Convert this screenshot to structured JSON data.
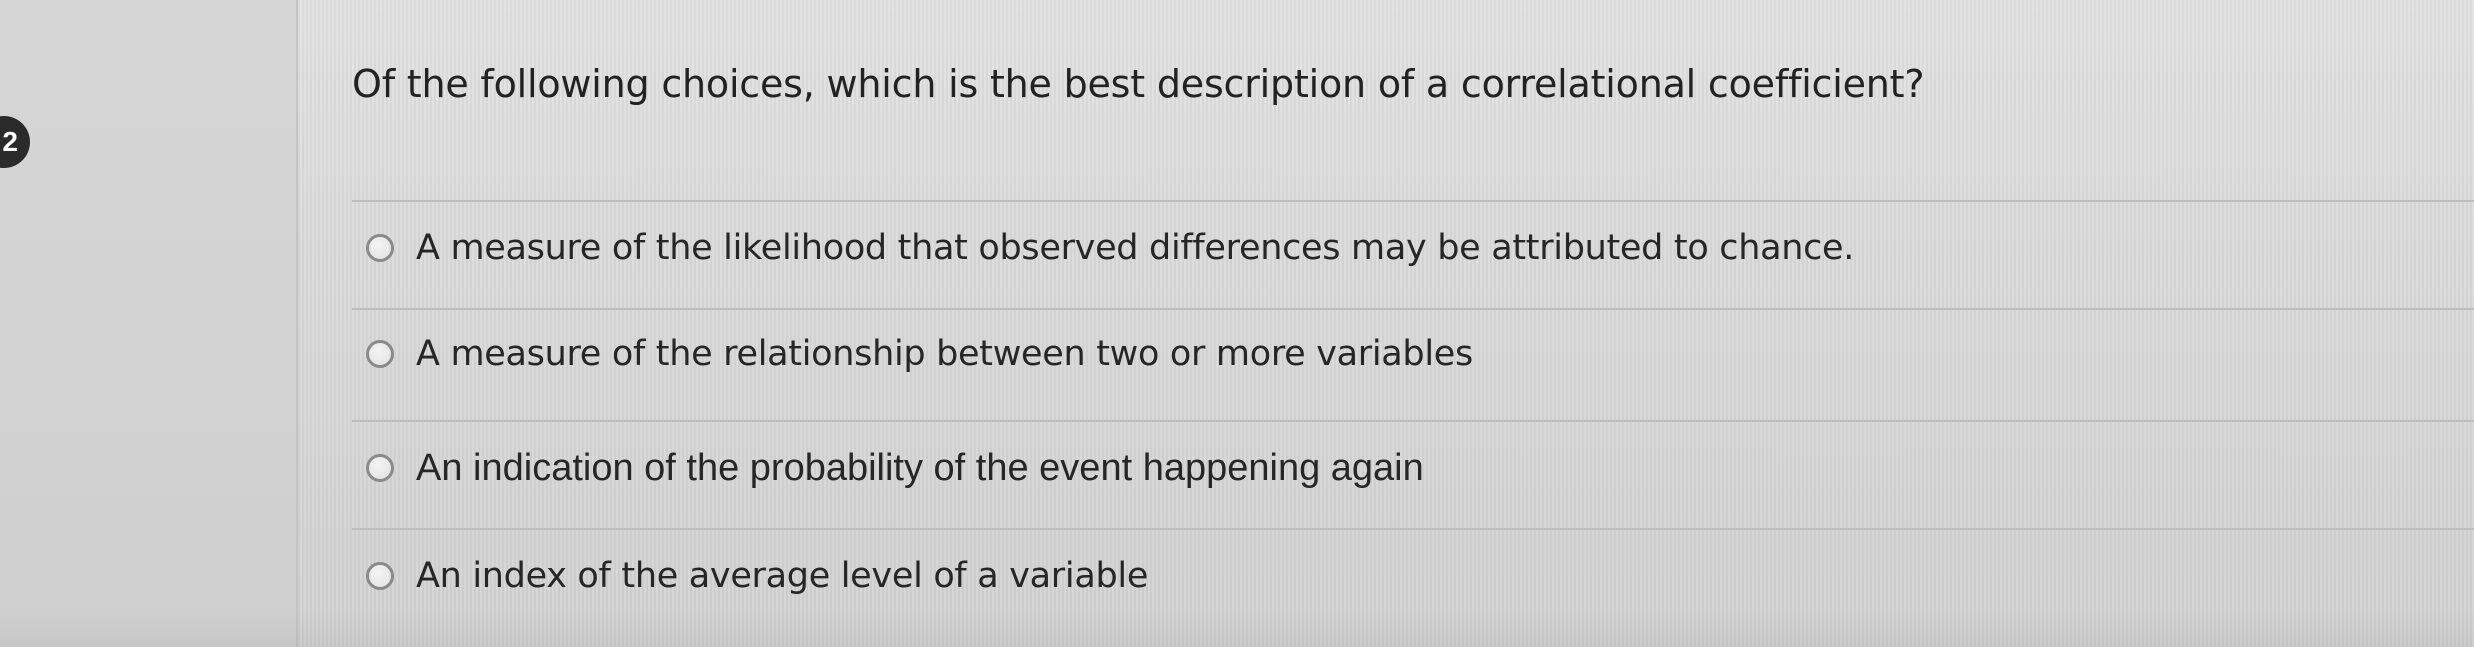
{
  "question": {
    "number": "2",
    "title": "Of the following choices, which is the best description of a correlational coefficient?"
  },
  "options": [
    {
      "label": "A measure of the likelihood that observed differences may be attributed to chance."
    },
    {
      "label": "A measure of the relationship between two or more variables"
    },
    {
      "label": "An indication of the probability of the event happening again"
    },
    {
      "label": "An index of the average level of a variable"
    }
  ],
  "colors": {
    "background": "#dcdcdc",
    "text": "#262626",
    "radio_border": "#8a8a8a",
    "badge": "#2a2a2a"
  }
}
